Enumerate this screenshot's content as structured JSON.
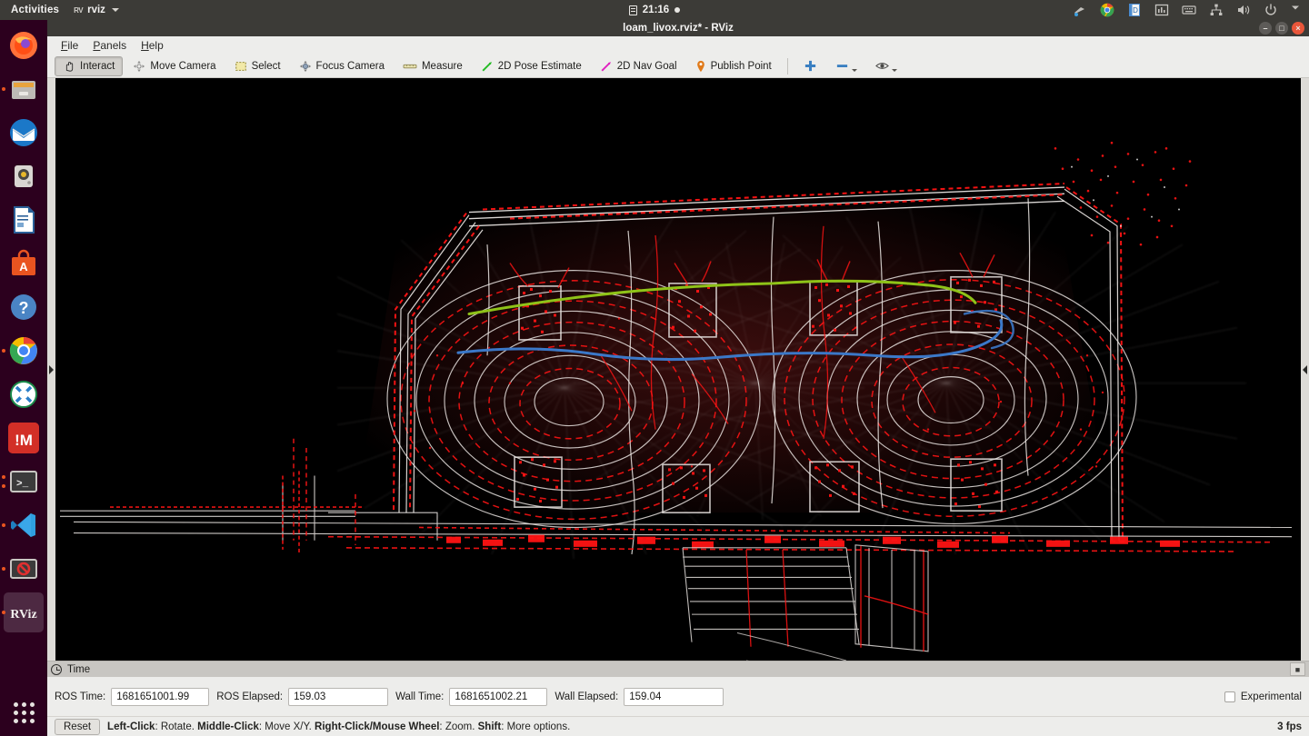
{
  "desktop": {
    "activities_label": "Activities",
    "app_menu": {
      "icon": "rviz-app-icon",
      "name": "rviz"
    },
    "clock": {
      "icon": "calendar-icon",
      "time": "21:16"
    },
    "tray": [
      {
        "name": "screencast-icon"
      },
      {
        "name": "chrome-icon"
      },
      {
        "name": "dictionary-icon"
      },
      {
        "name": "system-monitor-icon"
      },
      {
        "name": "keyboard-icon"
      },
      {
        "name": "network-icon"
      },
      {
        "name": "volume-icon"
      },
      {
        "name": "power-icon"
      },
      {
        "name": "chevron-down-icon"
      }
    ]
  },
  "dock": {
    "items": [
      {
        "name": "firefox",
        "label": "Firefox",
        "running": false,
        "active": false
      },
      {
        "name": "files",
        "label": "Files",
        "running": true,
        "active": false
      },
      {
        "name": "thunderbird",
        "label": "Thunderbird",
        "running": false,
        "active": false
      },
      {
        "name": "rhythmbox",
        "label": "Rhythmbox",
        "running": false,
        "active": false
      },
      {
        "name": "libreoffice-writer",
        "label": "LibreOffice Writer",
        "running": false,
        "active": false
      },
      {
        "name": "ubuntu-software",
        "label": "Ubuntu Software",
        "running": false,
        "active": false
      },
      {
        "name": "help",
        "label": "Help",
        "running": false,
        "active": false
      },
      {
        "name": "chrome",
        "label": "Google Chrome",
        "running": true,
        "active": false
      },
      {
        "name": "remote-desktop",
        "label": "Remmina",
        "running": false,
        "active": false
      },
      {
        "name": "matlab",
        "label": "!M",
        "running": false,
        "active": false
      },
      {
        "name": "terminal",
        "label": "Terminal",
        "running": true,
        "active": false
      },
      {
        "name": "vscode",
        "label": "Visual Studio Code",
        "running": true,
        "active": false
      },
      {
        "name": "blocked-screen",
        "label": "Blocked",
        "running": true,
        "active": false
      },
      {
        "name": "rviz",
        "label": "RViz",
        "running": true,
        "active": true
      }
    ],
    "show_apps_label": "Show Applications"
  },
  "window": {
    "title": "loam_livox.rviz* - RViz",
    "buttons": {
      "minimize": "–",
      "maximize": "□",
      "close": "×"
    }
  },
  "menubar": [
    {
      "name": "file",
      "mnemonic": "F",
      "rest": "ile"
    },
    {
      "name": "panels",
      "mnemonic": "P",
      "rest": "anels"
    },
    {
      "name": "help",
      "mnemonic": "H",
      "rest": "elp"
    }
  ],
  "toolbar": {
    "buttons": [
      {
        "name": "interact",
        "label": "Interact",
        "icon": "hand-icon",
        "pressed": true
      },
      {
        "name": "move-camera",
        "label": "Move Camera",
        "icon": "move-camera-icon",
        "pressed": false
      },
      {
        "name": "select",
        "label": "Select",
        "icon": "selection-box-icon",
        "pressed": false
      },
      {
        "name": "focus-camera",
        "label": "Focus Camera",
        "icon": "focus-camera-icon",
        "pressed": false
      },
      {
        "name": "measure",
        "label": "Measure",
        "icon": "ruler-icon",
        "pressed": false
      },
      {
        "name": "pose-estimate",
        "label": "2D Pose Estimate",
        "icon": "green-arrow-icon",
        "pressed": false
      },
      {
        "name": "nav-goal",
        "label": "2D Nav Goal",
        "icon": "magenta-arrow-icon",
        "pressed": false
      },
      {
        "name": "publish-point",
        "label": "Publish Point",
        "icon": "map-pin-icon",
        "pressed": false
      }
    ],
    "extra": [
      {
        "name": "add-tool",
        "icon": "plus-icon"
      },
      {
        "name": "remove-tool",
        "icon": "minus-icon"
      },
      {
        "name": "tool-properties",
        "icon": "eye-icon"
      }
    ]
  },
  "view3d": {
    "panel_collapse_left_icon": "chevron-right-icon",
    "panel_collapse_right_icon": "chevron-left-icon",
    "background_color": "#000000",
    "cloud_colors": {
      "intensity_high": "#ff1010",
      "intensity_low": "#ffffff"
    },
    "trajectories": [
      {
        "name": "odometry-path",
        "color": "#8fc318"
      },
      {
        "name": "mapped-path",
        "color": "#3b78c8"
      }
    ]
  },
  "time_panel": {
    "header": {
      "icon": "clock-icon",
      "title": "Time",
      "close_icon": "close-icon"
    },
    "fields": [
      {
        "name": "ros-time",
        "label": "ROS Time:",
        "value": "1681651001.99"
      },
      {
        "name": "ros-elapsed",
        "label": "ROS Elapsed:",
        "value": "159.03"
      },
      {
        "name": "wall-time",
        "label": "Wall Time:",
        "value": "1681651002.21"
      },
      {
        "name": "wall-elapsed",
        "label": "Wall Elapsed:",
        "value": "159.04"
      }
    ],
    "experimental": {
      "label": "Experimental",
      "checked": false
    }
  },
  "statusbar": {
    "reset_label": "Reset",
    "hints": [
      {
        "key": "Left-Click",
        "sep": ":",
        "action": " Rotate."
      },
      {
        "key": "Middle-Click",
        "sep": ":",
        "action": " Move X/Y."
      },
      {
        "key": "Right-Click/Mouse Wheel",
        "sep": ":",
        "action": " Zoom."
      },
      {
        "key": "Shift",
        "sep": ":",
        "action": " More options."
      }
    ],
    "fps": "3 fps"
  }
}
